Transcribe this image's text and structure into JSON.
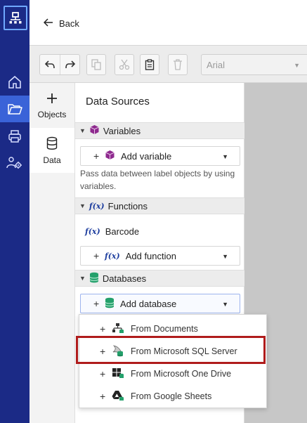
{
  "nav": {
    "back_label": "Back",
    "rail_items": [
      {
        "icon": "home-icon"
      },
      {
        "icon": "folder-open-icon",
        "active": true
      },
      {
        "icon": "printer-icon"
      },
      {
        "icon": "users-gear-icon"
      }
    ]
  },
  "toolbar": {
    "font_value": "Arial",
    "buttons": [
      "undo-icon",
      "redo-icon",
      "copy-icon",
      "cut-icon",
      "paste-icon",
      "delete-icon"
    ]
  },
  "side_tabs": {
    "objects_label": "Objects",
    "data_label": "Data"
  },
  "panel": {
    "title": "Data Sources",
    "variables": {
      "header": "Variables",
      "add_label": "Add variable",
      "description": "Pass data between label objects by using variables."
    },
    "functions": {
      "header": "Functions",
      "items": [
        "Barcode"
      ],
      "add_label": "Add function"
    },
    "databases": {
      "header": "Databases",
      "add_label": "Add database"
    }
  },
  "database_menu": {
    "items": [
      {
        "label": "From Documents",
        "icon": "documents-tree-icon"
      },
      {
        "label": "From Microsoft SQL Server",
        "icon": "sql-server-icon",
        "highlighted": true
      },
      {
        "label": "From Microsoft One Drive",
        "icon": "onedrive-icon"
      },
      {
        "label": "From Google Sheets",
        "icon": "google-drive-icon"
      }
    ]
  },
  "colors": {
    "rail": "#1b2a86",
    "rail_active": "#3a63d8",
    "accent_green": "#23a06b",
    "accent_purple": "#8e2a8e",
    "highlight_box": "#b01c1c"
  }
}
